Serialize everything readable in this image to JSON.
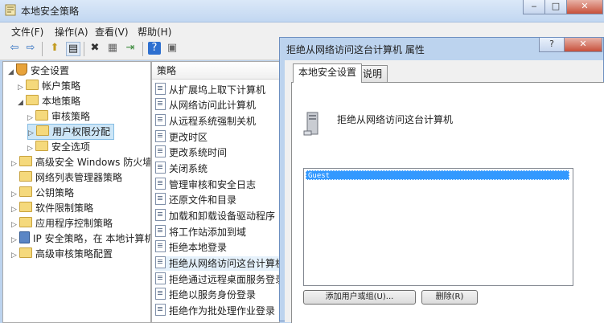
{
  "window": {
    "title": "本地安全策略"
  },
  "menu": [
    "文件(F)",
    "操作(A)",
    "查看(V)",
    "帮助(H)"
  ],
  "tree": {
    "items": [
      {
        "label": "安全设置",
        "level": 0,
        "expanded": true,
        "icon": "shield-icon"
      },
      {
        "label": "帐户策略",
        "level": 1,
        "expanded": false
      },
      {
        "label": "本地策略",
        "level": 1,
        "expanded": true
      },
      {
        "label": "审核策略",
        "level": 2,
        "expanded": false
      },
      {
        "label": "用户权限分配",
        "level": 2,
        "expanded": false,
        "selected": true
      },
      {
        "label": "安全选项",
        "level": 2,
        "expanded": false
      },
      {
        "label": "高级安全 Windows 防火墙",
        "level": 1,
        "expanded": false
      },
      {
        "label": "网络列表管理器策略",
        "level": 1,
        "expanded": null
      },
      {
        "label": "公钥策略",
        "level": 1,
        "expanded": false
      },
      {
        "label": "软件限制策略",
        "level": 1,
        "expanded": false
      },
      {
        "label": "应用程序控制策略",
        "level": 1,
        "expanded": false
      },
      {
        "label": "IP 安全策略，在 本地计算机",
        "level": 1,
        "expanded": false,
        "icon": "ip-policy-icon"
      },
      {
        "label": "高级审核策略配置",
        "level": 1,
        "expanded": false
      }
    ]
  },
  "list": {
    "header": "策略",
    "items": [
      "从扩展坞上取下计算机",
      "从网络访问此计算机",
      "从远程系统强制关机",
      "更改时区",
      "更改系统时间",
      "关闭系统",
      "管理审核和安全日志",
      "还原文件和目录",
      "加载和卸载设备驱动程序",
      "将工作站添加到域",
      "拒绝本地登录",
      "拒绝从网络访问这台计算机",
      "拒绝通过远程桌面服务登录",
      "拒绝以服务身份登录",
      "拒绝作为批处理作业登录"
    ],
    "selected_index": 11
  },
  "dialog": {
    "title": "拒绝从网络访问这台计算机 属性",
    "help_button": "?",
    "close_button": "✕",
    "tabs": [
      "本地安全设置",
      "说明"
    ],
    "policy_name": "拒绝从网络访问这台计算机",
    "users": [
      "Guest"
    ],
    "add_button": "添加用户或组(U)...",
    "remove_button": "删除(R)"
  },
  "colors": {
    "selection": "#3399ff",
    "titlebar": "#c2d7f1"
  }
}
